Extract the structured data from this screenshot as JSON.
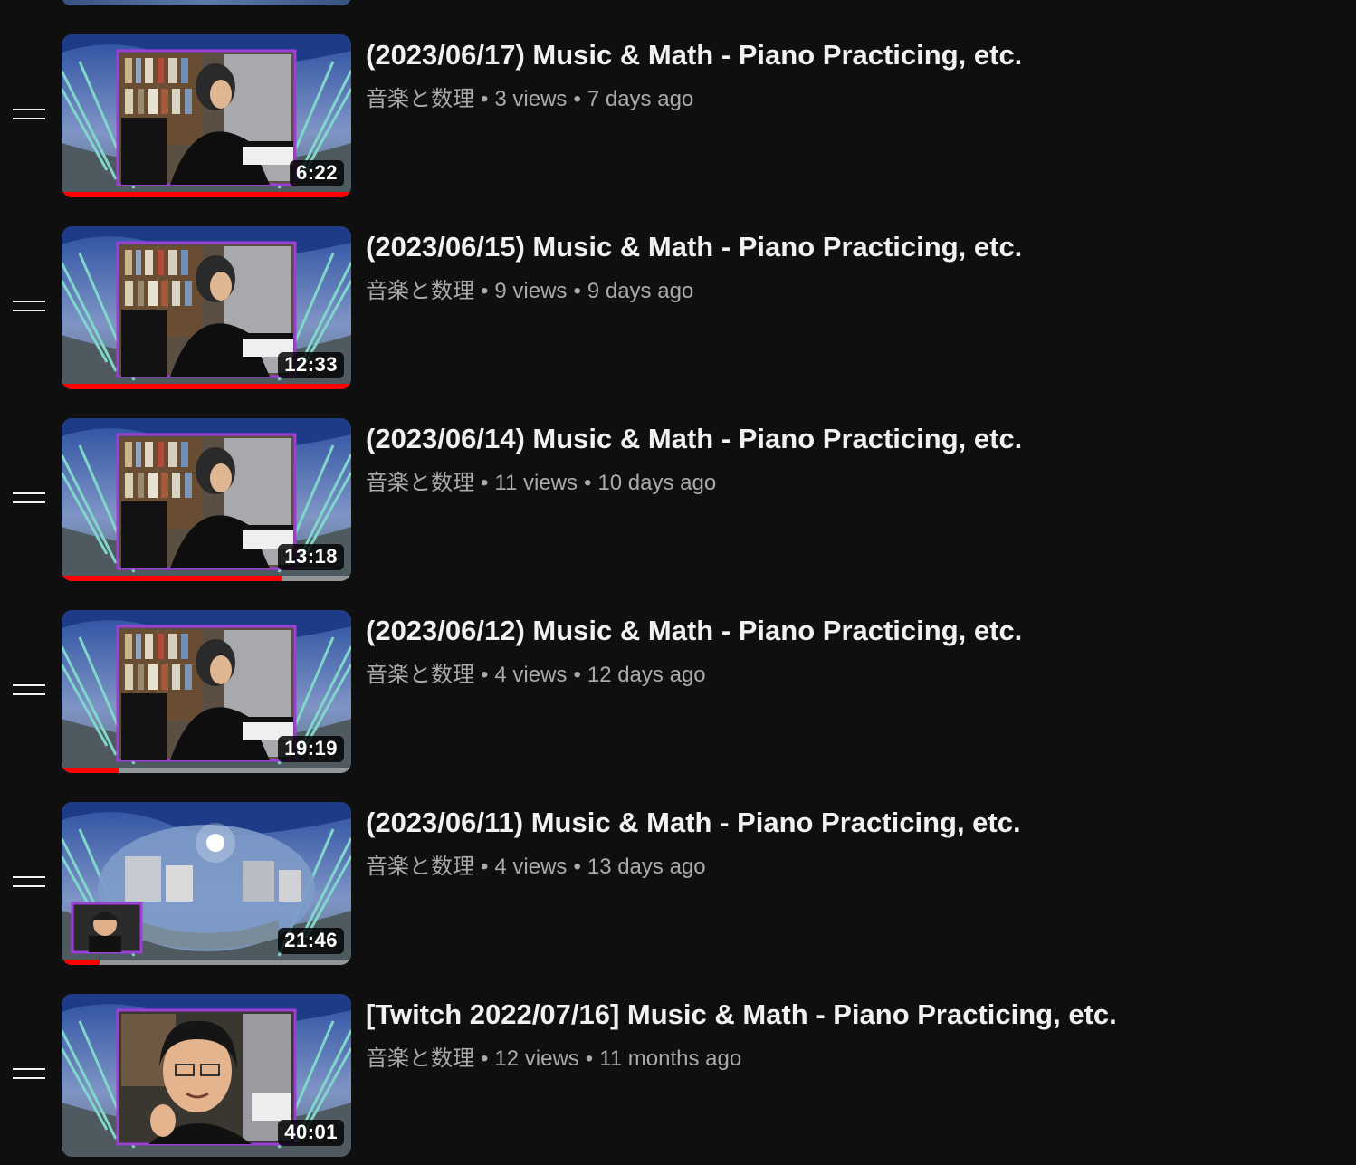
{
  "videos": [
    {
      "title": "(2023/06/17) Music & Math - Piano Practicing, etc.",
      "channel": "音楽と数理",
      "views": "3 views",
      "age": "7 days ago",
      "duration": "6:22",
      "watched_fraction": 1.0,
      "thumbnail_style": "piano-wide"
    },
    {
      "title": "(2023/06/15) Music & Math - Piano Practicing, etc.",
      "channel": "音楽と数理",
      "views": "9 views",
      "age": "9 days ago",
      "duration": "12:33",
      "watched_fraction": 1.0,
      "thumbnail_style": "piano-wide"
    },
    {
      "title": "(2023/06/14) Music & Math - Piano Practicing, etc.",
      "channel": "音楽と数理",
      "views": "11 views",
      "age": "10 days ago",
      "duration": "13:18",
      "watched_fraction": 0.76,
      "thumbnail_style": "piano-wide"
    },
    {
      "title": "(2023/06/12) Music & Math - Piano Practicing, etc.",
      "channel": "音楽と数理",
      "views": "4 views",
      "age": "12 days ago",
      "duration": "19:19",
      "watched_fraction": 0.2,
      "thumbnail_style": "piano-wide"
    },
    {
      "title": "(2023/06/11) Music & Math - Piano Practicing, etc.",
      "channel": "音楽と数理",
      "views": "4 views",
      "age": "13 days ago",
      "duration": "21:46",
      "watched_fraction": 0.13,
      "thumbnail_style": "panorama"
    },
    {
      "title": "[Twitch 2022/07/16] Music & Math - Piano Practicing, etc.",
      "channel": "音楽と数理",
      "views": "12 views",
      "age": "11 months ago",
      "duration": "40:01",
      "watched_fraction": 0.0,
      "thumbnail_style": "face"
    }
  ],
  "meta_separator": "•",
  "colors": {
    "background": "#0f0f0f",
    "title": "#f1f1f1",
    "meta": "#aaaaaa",
    "progress": "#ff0000",
    "frame_accent": "#9b3fd8"
  },
  "icons": {
    "drag_handle": "drag-handle-icon"
  }
}
